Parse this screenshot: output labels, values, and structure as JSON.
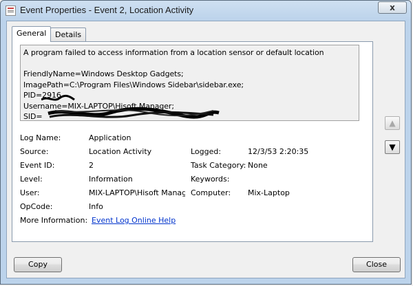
{
  "window": {
    "title": "Event Properties - Event 2, Location Activity",
    "close_glyph": "x"
  },
  "tabs": [
    {
      "label": "General",
      "active": true
    },
    {
      "label": "Details",
      "active": false
    }
  ],
  "description": {
    "lines": [
      "A program failed to access information from a location sensor or default location",
      "",
      "FriendlyName=Windows Desktop Gadgets;",
      "ImagePath=C:\\Program Files\\Windows Sidebar\\sidebar.exe;",
      "PID=2916",
      "Username=MIX-LAPTOP\\Hisoft Manager;",
      "SID="
    ]
  },
  "fields": {
    "log_name": {
      "label": "Log Name:",
      "value": "Application"
    },
    "source": {
      "label": "Source:",
      "value": "Location Activity"
    },
    "logged": {
      "label": "Logged:",
      "value": "12/3/53 2:20:35"
    },
    "event_id": {
      "label": "Event ID:",
      "value": "2"
    },
    "task_category": {
      "label": "Task Category:",
      "value": "None"
    },
    "level": {
      "label": "Level:",
      "value": "Information"
    },
    "keywords": {
      "label": "Keywords:",
      "value": ""
    },
    "user": {
      "label": "User:",
      "value": "MIX-LAPTOP\\Hisoft Manag"
    },
    "computer": {
      "label": "Computer:",
      "value": "Mix-Laptop"
    },
    "opcode": {
      "label": "OpCode:",
      "value": "Info"
    },
    "more_info": {
      "label": "More Information:",
      "link": "Event Log Online Help"
    }
  },
  "side_buttons": {
    "up_icon": "arrow-up-icon",
    "down_icon": "arrow-down-icon"
  },
  "buttons": {
    "copy": "Copy",
    "close": "Close"
  }
}
